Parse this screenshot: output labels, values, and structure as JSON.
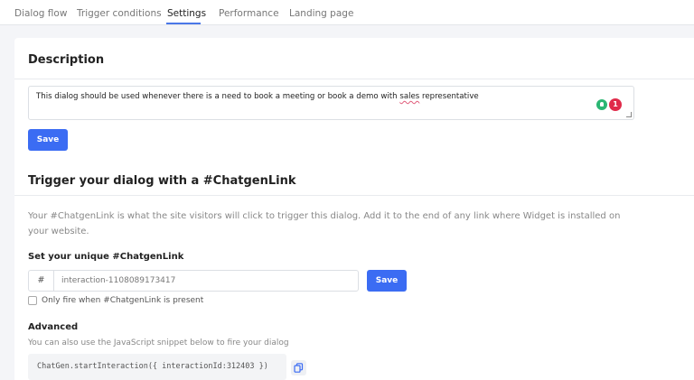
{
  "tabs": [
    {
      "label": "Dialog flow",
      "active": false
    },
    {
      "label": "Trigger conditions",
      "active": false
    },
    {
      "label": "Settings",
      "active": true
    },
    {
      "label": "Performance",
      "active": false
    },
    {
      "label": "Landing page",
      "active": false
    }
  ],
  "description": {
    "heading": "Description",
    "text_before": "This dialog should be used whenever there is a need to book a meeting or book a demo with ",
    "text_misspelled": "sales",
    "text_after": " representative",
    "extension_badge_count": "1",
    "save_label": "Save"
  },
  "trigger": {
    "heading": "Trigger your dialog with a #ChatgenLink",
    "paragraph": "Your #ChatgenLink is what the site visitors will click to trigger this dialog. Add it to the end of any link where Widget is installed on your website.",
    "unique_label": "Set your unique #ChatgenLink",
    "prefix": "#",
    "link_value": "interaction-1108089173417",
    "save_label": "Save",
    "checkbox_label": "Only fire when #ChatgenLink is present",
    "checkbox_checked": false
  },
  "advanced": {
    "heading": "Advanced",
    "subtext": "You can also use the JavaScript snippet below to fire your dialog",
    "code_snippet": "ChatGen.startInteraction({ interactionId:312403 })",
    "copy_icon": "copy-icon"
  },
  "colors": {
    "accent": "#3b6cf3",
    "tab_underline": "#4a77e8",
    "badge_red": "#e02b4a",
    "bulb_green": "#2bb673"
  }
}
